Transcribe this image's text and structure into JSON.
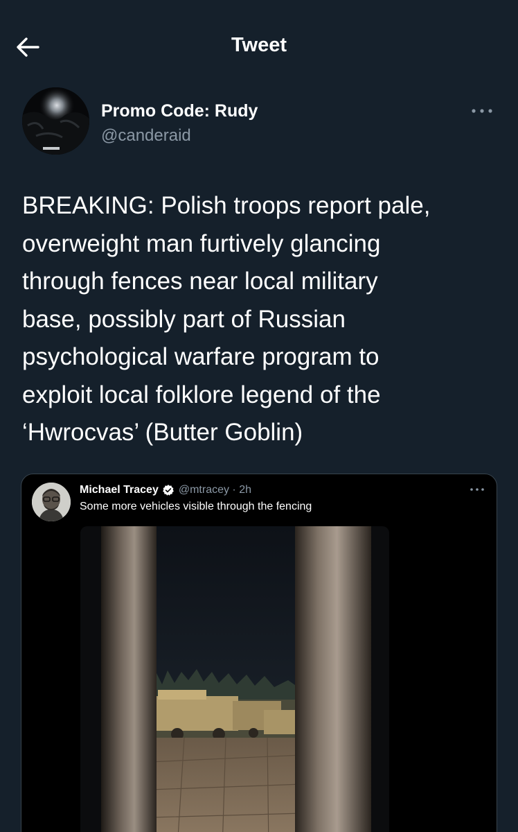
{
  "header": {
    "title": "Tweet",
    "back_icon": "arrow-left-icon"
  },
  "tweet": {
    "author_name": "Promo Code: Rudy",
    "author_handle": "@canderaid",
    "text": "BREAKING: Polish troops report pale,\noverweight man furtively glancing\nthrough fences near local military\nbase, possibly part of Russian\npsychological warfare program to\nexploit local folklore legend of the\n‘Hwrocvas’ (Butter Goblin)",
    "more_icon": "more-horizontal-icon"
  },
  "quoted_tweet": {
    "author_name": "Michael Tracey",
    "verified_icon": "verified-badge-icon",
    "handle_time": "@mtracey · 2h",
    "text": "Some more vehicles visible through the fencing",
    "media": "photo-military-vehicles-through-fence"
  },
  "colors": {
    "background": "#15202b",
    "text": "#ffffff",
    "secondary_text": "#8b98a5",
    "border": "#38444d",
    "accent": "#1d9bf0"
  }
}
